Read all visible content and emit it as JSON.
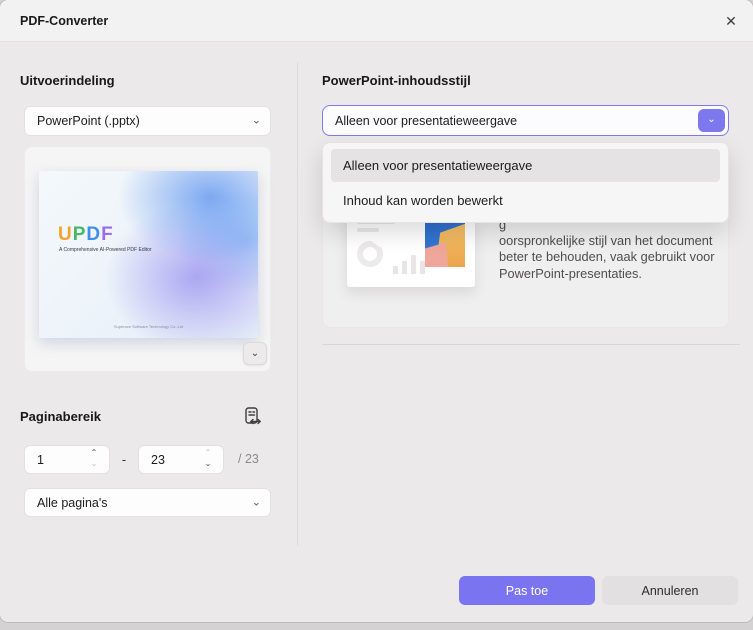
{
  "window": {
    "title": "PDF-Converter"
  },
  "icons": {
    "close": "✕",
    "chevron_down": "⌄",
    "chevron_up": "⌃"
  },
  "left": {
    "output_section": {
      "heading": "Uitvoerindeling",
      "format_select": {
        "value": "PowerPoint (.pptx)"
      }
    },
    "preview": {
      "logo": {
        "0": {
          "ch": "U"
        },
        "1": {
          "ch": "P"
        },
        "2": {
          "ch": "D"
        },
        "3": {
          "ch": "F"
        }
      },
      "subtitle": "A Comprehensive AI-Powered PDF Editor",
      "fine_print": "Superace Software Technology Co.,Ltd"
    },
    "page_range": {
      "heading": "Paginabereik",
      "from": "1",
      "separator": "-",
      "to": "23",
      "total": "/ 23",
      "scope_select": {
        "value": "Alle pagina's"
      }
    }
  },
  "right": {
    "heading": "PowerPoint-inhoudsstijl",
    "style_select": {
      "value": "Alleen voor presentatieweergave"
    },
    "dropdown": {
      "options": [
        {
          "label": "Alleen voor presentatieweergave",
          "selected": true
        },
        {
          "label": "Inhoud kan worden bewerkt",
          "selected": false
        }
      ]
    },
    "info_card": {
      "description_lines": {
        "0": "g",
        "1": "oorspronkelijke stijl van het document",
        "2": "beter te behouden, vaak gebruikt voor",
        "3": "PowerPoint-presentaties."
      }
    }
  },
  "footer": {
    "apply_label": "Pas toe",
    "cancel_label": "Annuleren"
  },
  "colors": {
    "accent": "#7b74f1",
    "select_border": "#7e79ee",
    "titlebar_bg": "#f3f2f2",
    "content_bg": "#ebe9e9",
    "highlight_row": "#e5e3e3",
    "logo_u": "#f6a12e",
    "logo_p": "#47b865",
    "logo_d": "#3e8ef0",
    "logo_f": "#9b6cf2"
  }
}
